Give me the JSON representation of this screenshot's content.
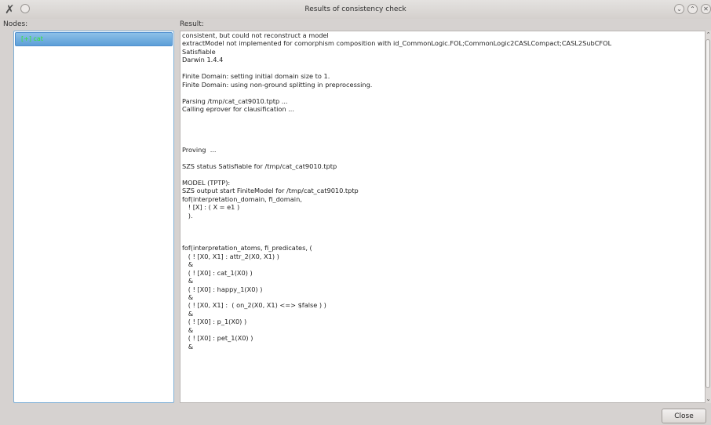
{
  "window": {
    "title": "Results of consistency check",
    "app_icon": "✗",
    "buttons": {
      "minimize": "⌄",
      "maximize": "⌃",
      "close": "✕"
    }
  },
  "labels": {
    "nodes": "Nodes:",
    "result": "Result:"
  },
  "nodes": [
    {
      "label": "[+] cat"
    }
  ],
  "result_lines": [
    "consistent, but could not reconstruct a model",
    "extractModel not implemented for comorphism composition with id_CommonLogic.FOL;CommonLogic2CASLCompact;CASL2SubCFOL",
    "Satisfiable",
    "Darwin 1.4.4",
    "",
    "Finite Domain: setting initial domain size to 1.",
    "Finite Domain: using non-ground splitting in preprocessing.",
    "",
    "Parsing /tmp/cat_cat9010.tptp ...",
    "Calling eprover for clausification ...",
    "",
    "",
    "",
    "",
    "Proving  ...",
    "",
    "SZS status Satisfiable for /tmp/cat_cat9010.tptp",
    "",
    "MODEL (TPTP):",
    "SZS output start FiniteModel for /tmp/cat_cat9010.tptp",
    "fof(interpretation_domain, fi_domain,",
    "   ! [X] : ( X = e1 )",
    "   ).",
    "",
    "",
    "",
    "fof(interpretation_atoms, fi_predicates, (",
    "   ( ! [X0, X1] : attr_2(X0, X1) )",
    "   &",
    "   ( ! [X0] : cat_1(X0) )",
    "   &",
    "   ( ! [X0] : happy_1(X0) )",
    "   &",
    "   ( ! [X0, X1] :  ( on_2(X0, X1) <=> $false ) )",
    "   &",
    "   ( ! [X0] : p_1(X0) )",
    "   &",
    "   ( ! [X0] : pet_1(X0) )",
    "   &"
  ],
  "scrollbar": {
    "up": "⌃",
    "down": "⌄"
  },
  "footer": {
    "close_label": "Close"
  }
}
